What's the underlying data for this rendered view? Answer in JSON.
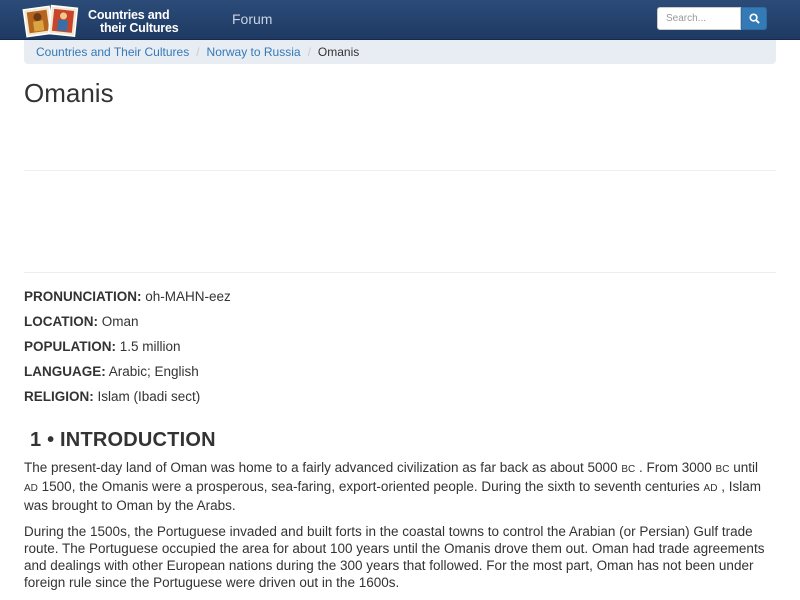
{
  "header": {
    "brand_line1": "Countries and",
    "brand_line2": "their Cultures",
    "forum_label": "Forum",
    "search_placeholder": "Search..."
  },
  "breadcrumb": {
    "items": [
      "Countries and Their Cultures",
      "Norway to Russia"
    ],
    "current": "Omanis"
  },
  "page": {
    "title": "Omanis"
  },
  "facts": [
    {
      "label": "PRONUNCIATION:",
      "value": " oh-MAHN-eez"
    },
    {
      "label": "LOCATION:",
      "value": " Oman"
    },
    {
      "label": "POPULATION:",
      "value": " 1.5 million"
    },
    {
      "label": "LANGUAGE:",
      "value": " Arabic; English"
    },
    {
      "label": "RELIGION:",
      "value": " Islam (Ibadi sect)"
    }
  ],
  "section": {
    "heading": "1 • INTRODUCTION",
    "p1": {
      "a": "The present-day land of Oman was home to a fairly advanced civilization as far back as about 5000 ",
      "bc1": "BC",
      "b": " . From 3000 ",
      "bc2": "BC",
      "c": " until ",
      "ad1": "AD",
      "d": " 1500, the Omanis were a prosperous, sea-faring, export-oriented people. During the sixth to seventh centuries ",
      "ad2": "AD",
      "e": " , Islam was brought to Oman by the Arabs."
    },
    "p2": "During the 1500s, the Portuguese invaded and built forts in the coastal towns to control the Arabian (or Persian) Gulf trade route. The Portuguese occupied the area for about 100 years until the Omanis drove them out. Oman had trade agreements and dealings with other European nations during the 300 years that followed. For the most part, Oman has not been under foreign rule since the Portuguese were driven out in the 1600s."
  }
}
